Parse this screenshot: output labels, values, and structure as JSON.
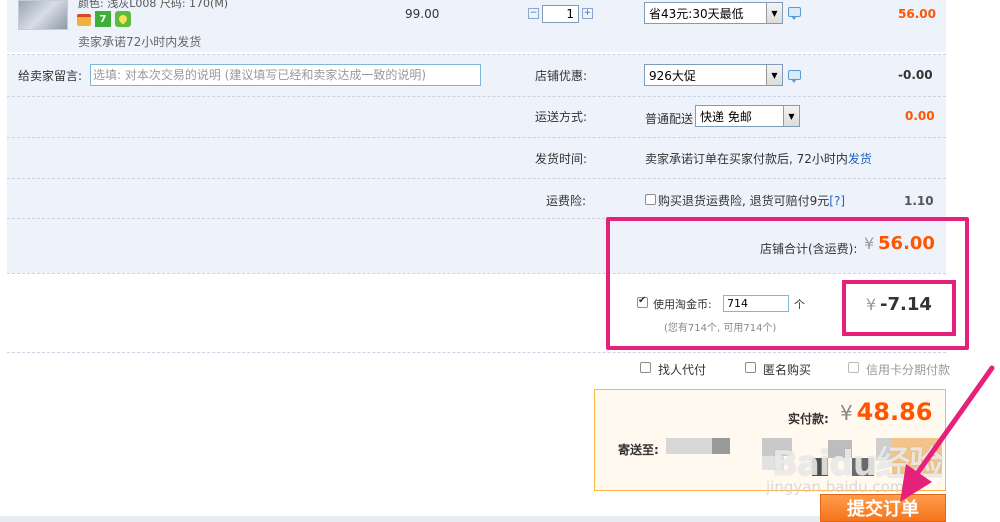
{
  "item": {
    "attrs": "颜色: 浅灰L008   尺码: 170(M)",
    "ship_promise": "卖家承诺72小时内发货",
    "price": "99.00",
    "quantity": "1",
    "promo_select": "省43元:30天最低",
    "subtotal": "56.00"
  },
  "message": {
    "label": "给卖家留言:",
    "placeholder": "选填: 对本次交易的说明 (建议填写已经和卖家达成一致的说明)"
  },
  "shop_discount": {
    "label": "店铺优惠:",
    "selected": "926大促",
    "amount": "-0.00"
  },
  "shipping": {
    "label": "运送方式:",
    "method_text": "普通配送",
    "selected": "快递 免邮",
    "amount": "0.00"
  },
  "ship_time": {
    "label": "发货时间:",
    "text": "卖家承诺订单在买家付款后, 72小时内",
    "link": "发货"
  },
  "insurance": {
    "label": "运费险:",
    "text": "购买退货运费险, 退货可赔付9元",
    "help": "[?]",
    "amount": "1.10"
  },
  "shop_total": {
    "label": "店铺合计(含运费):",
    "currency": "¥",
    "value": "56.00"
  },
  "coins": {
    "label": "使用淘金币:",
    "value": "714",
    "unit": "个",
    "note": "(您有714个, 可用714个)",
    "currency": "¥",
    "discount": "-7.14"
  },
  "options": {
    "find_pay": "找人代付",
    "anonymous": "匿名购买",
    "installment": "信用卡分期付款"
  },
  "payment": {
    "label": "实付款:",
    "currency": "¥",
    "value": "48.86",
    "ship_to_label": "寄送至:"
  },
  "submit": {
    "label": "提交订单"
  },
  "watermark": {
    "logo": "Baidu经验",
    "url": "jingyan.baidu.com"
  },
  "colors": {
    "accent_orange": "#ff5500",
    "highlight_pink": "#e5217c",
    "panel_bg": "#eef3fb",
    "link_blue": "#1f64c2"
  }
}
